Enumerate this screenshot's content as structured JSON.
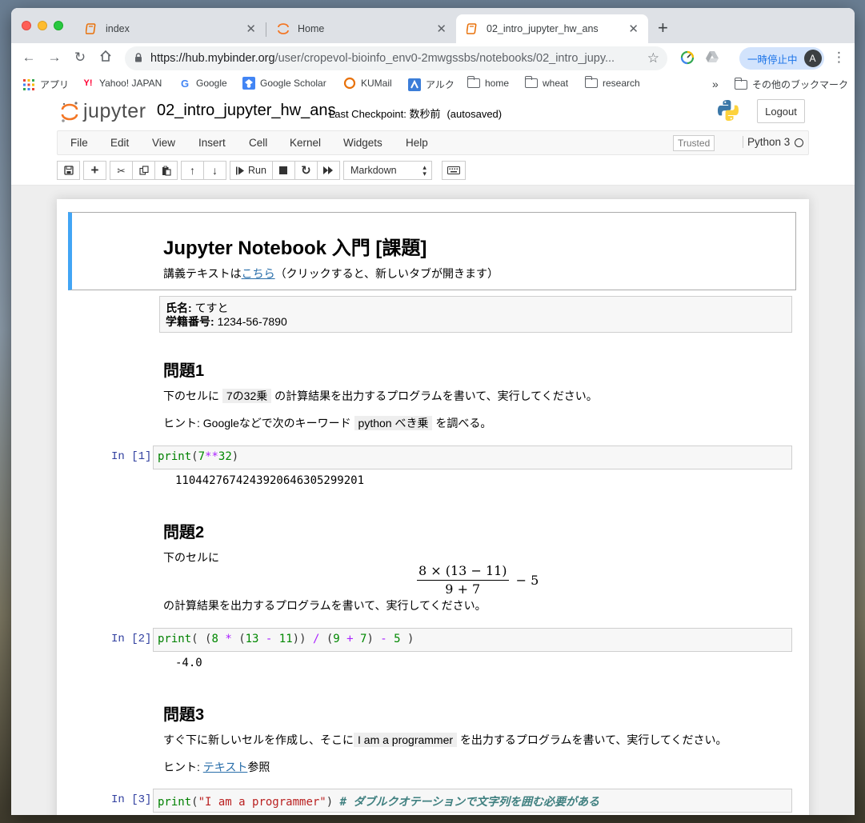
{
  "browser": {
    "tabs": [
      {
        "title": "index",
        "icon": "book-icon"
      },
      {
        "title": "Home",
        "icon": "jupyter-icon"
      },
      {
        "title": "02_intro_jupyter_hw_ans",
        "icon": "book-icon",
        "active": true
      }
    ],
    "url_host": "https://hub.mybinder.org",
    "url_path": "/user/cropevol-bioinfo_env0-2mwgssbs/notebooks/02_intro_jupy...",
    "pause_label": "一時停止中",
    "avatar_letter": "A"
  },
  "bookmarks": {
    "items": [
      "アプリ",
      "Yahoo! JAPAN",
      "Google",
      "Google Scholar",
      "KUMail",
      "アルク",
      "home",
      "wheat",
      "research"
    ],
    "more": "»",
    "other": "その他のブックマーク"
  },
  "jupyter": {
    "logo_text": "jupyter",
    "notebook_name": "02_intro_jupyter_hw_ans",
    "checkpoint": "Last Checkpoint: 数秒前",
    "autosaved": "(autosaved)",
    "logout": "Logout",
    "menu": [
      "File",
      "Edit",
      "View",
      "Insert",
      "Cell",
      "Kernel",
      "Widgets",
      "Help"
    ],
    "trusted": "Trusted",
    "kernel": "Python 3",
    "run_label": "Run",
    "cell_type": "Markdown"
  },
  "notebook": {
    "title": "Jupyter Notebook 入門 [課題]",
    "intro_pre": "講義テキストは",
    "intro_link": "こちら",
    "intro_post": "（クリックすると、新しいタブが開きます）",
    "name_label": "氏名:",
    "name_value": "てすと",
    "id_label": "学籍番号:",
    "id_value": "1234-56-7890",
    "q1": {
      "heading": "問題1",
      "p1_pre": "下のセルに",
      "p1_code": "7の32乗",
      "p1_post": "の計算結果を出力するプログラムを書いて、実行してください。",
      "p2_pre": "ヒント: Googleなどで次のキーワード",
      "p2_code": "python べき乗",
      "p2_post": "を調べる。",
      "prompt": "In [1]:",
      "output": "1104427674243920646305299201"
    },
    "q2": {
      "heading": "問題2",
      "p1": "下のセルに",
      "math_num": "8 × (13 − 11)",
      "math_den": "9 + 7",
      "math_tail": "− 5",
      "p2": "の計算結果を出力するプログラムを書いて、実行してください。",
      "prompt": "In [2]:",
      "output": "-4.0"
    },
    "q3": {
      "heading": "問題3",
      "p1_pre": "すぐ下に新しいセルを作成し、そこに",
      "p1_code": "I am a programmer",
      "p1_post": "を出力するプログラムを書いて、実行してください。",
      "p2_pre": "ヒント:",
      "p2_link": "テキスト",
      "p2_post": "参照",
      "prompt": "In [3]:",
      "comment": "# ダブルクオテーションで文字列を囲む必要がある"
    }
  }
}
